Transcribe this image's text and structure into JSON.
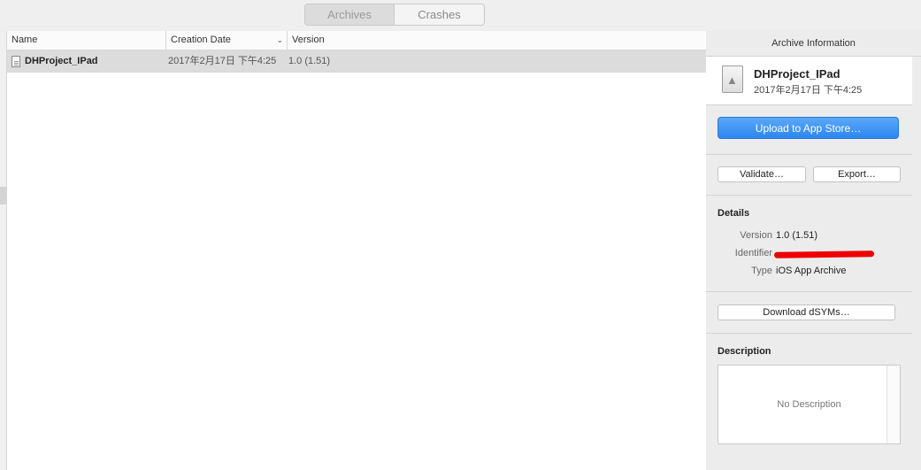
{
  "tabs": {
    "archives": "Archives",
    "crashes": "Crashes"
  },
  "table": {
    "columns": {
      "name": "Name",
      "date": "Creation Date",
      "version": "Version"
    },
    "rows": [
      {
        "name": "DHProject_IPad",
        "date": "2017年2月17日 下午4:25",
        "version": "1.0 (1.51)"
      }
    ]
  },
  "inspector": {
    "title": "Archive Information",
    "archive_name": "DHProject_IPad",
    "archive_date": "2017年2月17日 下午4:25",
    "upload_label": "Upload to App Store…",
    "validate_label": "Validate…",
    "export_label": "Export…",
    "details_title": "Details",
    "details": {
      "version_key": "Version",
      "version_val": "1.0 (1.51)",
      "identifier_key": "Identifier",
      "type_key": "Type",
      "type_val": "iOS App Archive"
    },
    "dsyms_label": "Download dSYMs…",
    "description_title": "Description",
    "description_placeholder": "No Description"
  },
  "icons": {
    "sort": "chevron-down-icon",
    "row": "document-icon",
    "archive": "archive-icon"
  },
  "colors": {
    "primary_button": "#2d86f1",
    "selection": "#dcdcdc",
    "redaction": "#ee0000"
  }
}
